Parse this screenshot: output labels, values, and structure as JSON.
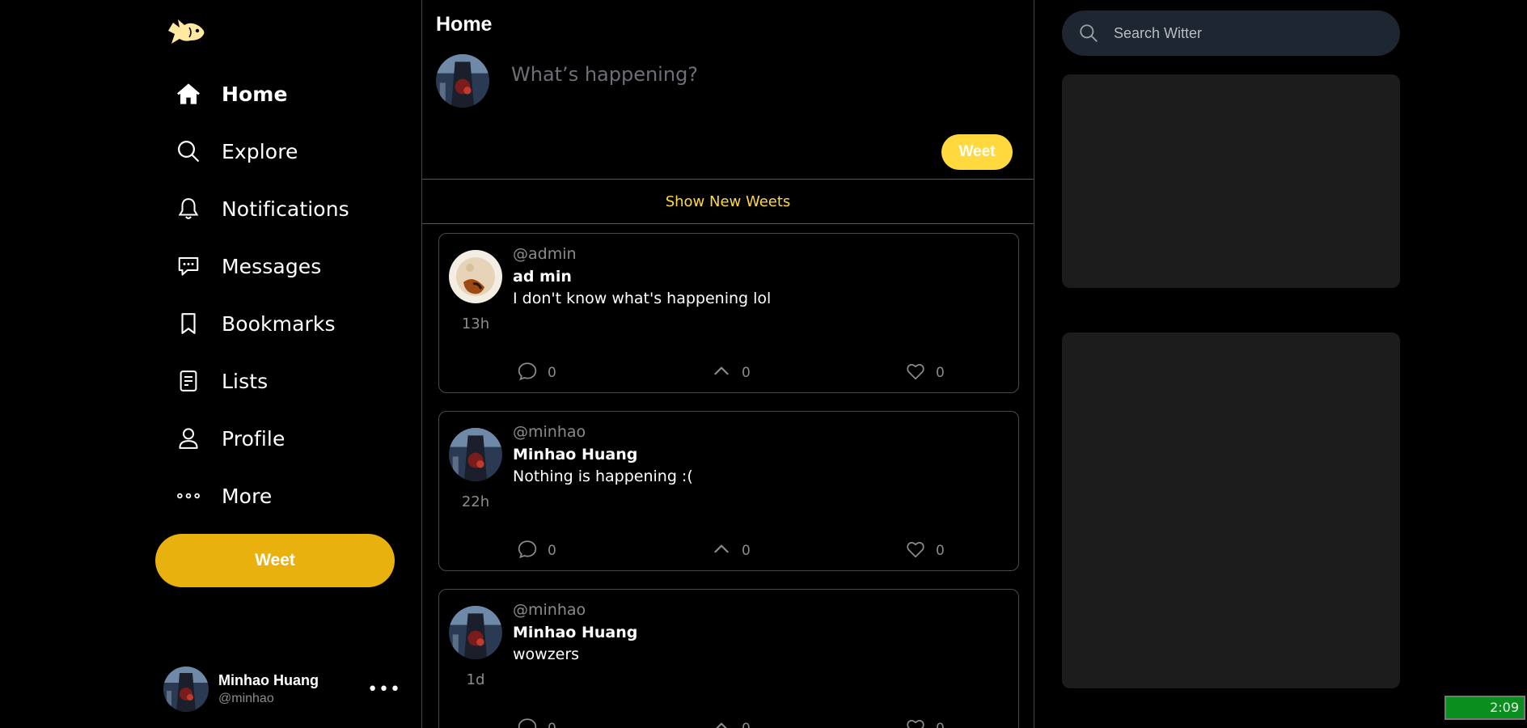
{
  "nav": {
    "items": [
      {
        "label": "Home",
        "icon": "home-icon"
      },
      {
        "label": "Explore",
        "icon": "search-icon"
      },
      {
        "label": "Notifications",
        "icon": "bell-icon"
      },
      {
        "label": "Messages",
        "icon": "message-icon"
      },
      {
        "label": "Bookmarks",
        "icon": "bookmark-icon"
      },
      {
        "label": "Lists",
        "icon": "list-icon"
      },
      {
        "label": "Profile",
        "icon": "user-icon"
      },
      {
        "label": "More",
        "icon": "more-icon"
      }
    ],
    "weet_label": "Weet",
    "user": {
      "name": "Minhao Huang",
      "handle": "@minhao"
    }
  },
  "main": {
    "title": "Home",
    "compose_placeholder": "What’s happening?",
    "weet_label": "Weet",
    "show_new": "Show New Weets",
    "tweets": [
      {
        "handle": "@admin",
        "name": "ad min",
        "text": "I don't know what's happening lol",
        "time": "13h",
        "replies": "0",
        "upvotes": "0",
        "likes": "0"
      },
      {
        "handle": "@minhao",
        "name": "Minhao Huang",
        "text": "Nothing is happening :(",
        "time": "22h",
        "replies": "0",
        "upvotes": "0",
        "likes": "0"
      },
      {
        "handle": "@minhao",
        "name": "Minhao Huang",
        "text": "wowzers",
        "time": "1d",
        "replies": "0",
        "upvotes": "0",
        "likes": "0"
      }
    ]
  },
  "right": {
    "search_placeholder": "Search Witter"
  },
  "clock": "2:09",
  "colors": {
    "accent": "#FFD93D",
    "weet_button": "#E9B10E",
    "panel": "#1c1c1c",
    "search_bg": "#1e2631"
  }
}
